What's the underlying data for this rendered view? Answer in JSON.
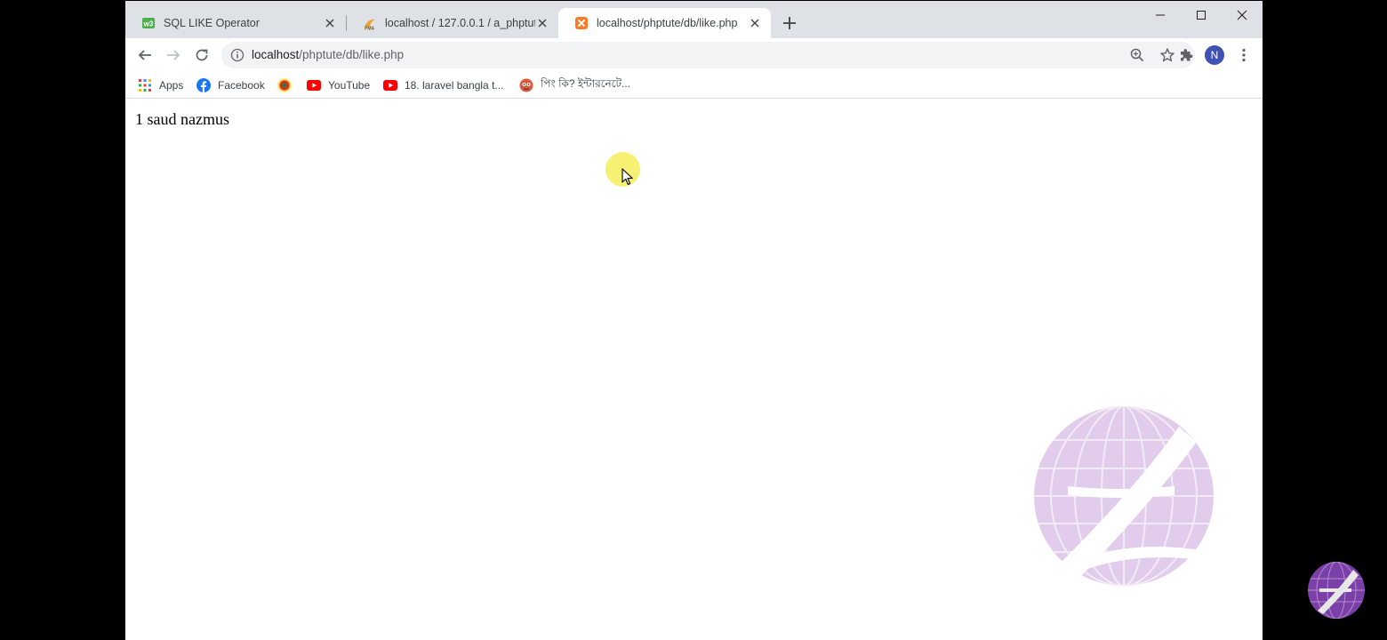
{
  "tabs": [
    {
      "title": "SQL LIKE Operator",
      "icon": "w3schools-icon"
    },
    {
      "title": "localhost / 127.0.0.1 / a_phptute",
      "icon": "phpmyadmin-icon"
    },
    {
      "title": "localhost/phptute/db/like.php",
      "icon": "xampp-icon"
    }
  ],
  "omnibox": {
    "host": "localhost",
    "path": "/phptute/db/like.php"
  },
  "profile": {
    "initial": "N"
  },
  "bookmarks": [
    {
      "label": "Apps",
      "icon": "apps-grid-icon"
    },
    {
      "label": "Facebook",
      "icon": "facebook-icon"
    },
    {
      "label": "",
      "icon": "seal-icon"
    },
    {
      "label": "YouTube",
      "icon": "youtube-icon"
    },
    {
      "label": "18. laravel bangla t...",
      "icon": "youtube-icon"
    },
    {
      "label": "পিং কি? ইন্টারনেটে...",
      "icon": "site-icon"
    }
  ],
  "page": {
    "result_text": "1 saud nazmus"
  },
  "colors": {
    "tabstrip": "#dee1e6",
    "omnibox": "#f1f3f4",
    "avatar": "#3f51b5",
    "highlight": "#f5ef5a",
    "watermark": "#c9a6dc"
  }
}
